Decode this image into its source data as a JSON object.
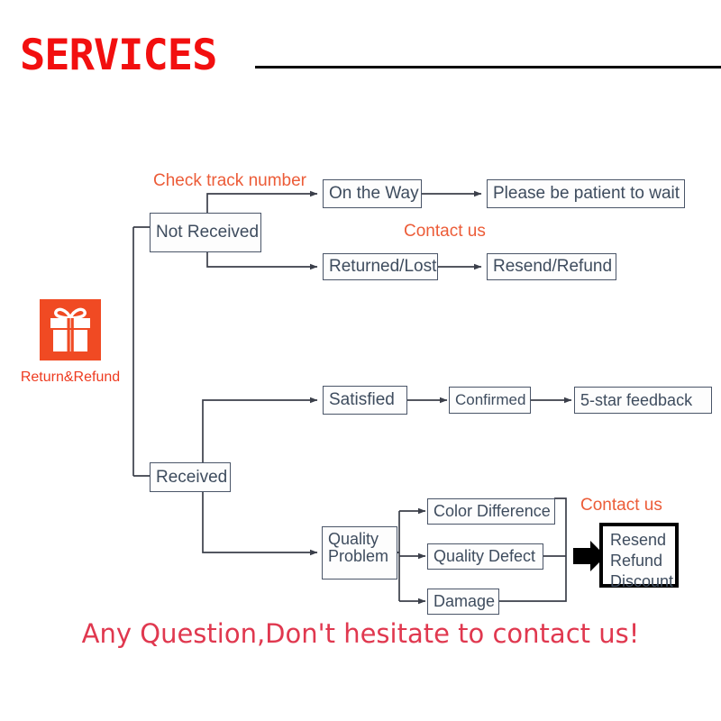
{
  "header": {
    "title": "SERVICES",
    "rule_color": "#000000",
    "title_color": "#f20f0f"
  },
  "gift": {
    "icon_name": "gift-box-icon",
    "caption": "Return&Refund",
    "square_color": "#f04a23",
    "caption_color": "#ee3b20"
  },
  "annotations": [
    {
      "id": "check-track-number",
      "text": "Check track number"
    },
    {
      "id": "contact-us-top",
      "text": "Contact us"
    },
    {
      "id": "contact-us-bottom",
      "text": "Contact us"
    }
  ],
  "nodes": {
    "not_received": "Not Received",
    "on_the_way": "On the Way",
    "please_wait": "Please be patient to wait",
    "returned_lost": "Returned/Lost",
    "resend_refund": "Resend/Refund",
    "received": "Received",
    "satisfied": "Satisfied",
    "confirmed": "Confirmed",
    "five_star": "5-star feedback",
    "quality_problem": "Quality\nProblem",
    "color_difference": "Color Difference",
    "quality_defect": "Quality Defect",
    "damage": "Damage",
    "resend_refund_discount": "Resend\nRefund\nDiscount"
  },
  "footer": {
    "slogan": "Any Question,Don't hesitate to contact us!",
    "color": "#e0384f"
  },
  "palette": {
    "box_border": "#4a5568",
    "box_text": "#3e4c5e",
    "annotation": "#ec5c38",
    "wire": "#3b3f4a"
  }
}
